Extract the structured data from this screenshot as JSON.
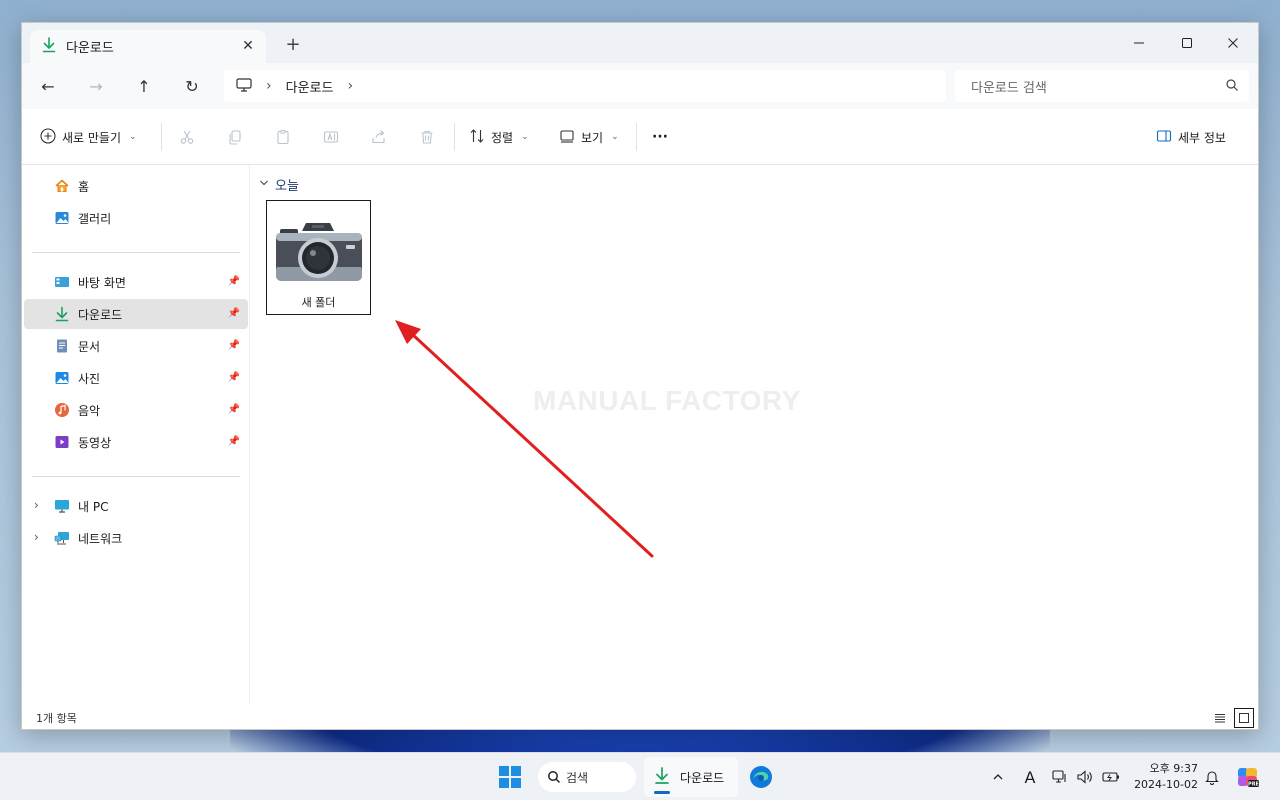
{
  "window": {
    "tab_title": "다운로드",
    "tab_close": "✕",
    "new_tab": "+"
  },
  "nav": {
    "back": "←",
    "forward": "→",
    "up": "↑",
    "refresh": "↻"
  },
  "address": {
    "crumbs": [
      "다운로드"
    ],
    "chevron": "›"
  },
  "search": {
    "placeholder": "다운로드 검색"
  },
  "toolbar": {
    "new_label": "새로 만들기",
    "sort_label": "정렬",
    "view_label": "보기",
    "more_label": "···",
    "details_label": "세부 정보"
  },
  "sidebar": {
    "items": [
      {
        "label": "홈",
        "icon": "home-icon"
      },
      {
        "label": "갤러리",
        "icon": "gallery-icon"
      },
      {
        "label": "바탕 화면",
        "icon": "desktop-icon",
        "pinned": true
      },
      {
        "label": "다운로드",
        "icon": "download-icon",
        "pinned": true,
        "selected": true
      },
      {
        "label": "문서",
        "icon": "document-icon",
        "pinned": true
      },
      {
        "label": "사진",
        "icon": "pictures-icon",
        "pinned": true
      },
      {
        "label": "음악",
        "icon": "music-icon",
        "pinned": true
      },
      {
        "label": "동영상",
        "icon": "video-icon",
        "pinned": true
      },
      {
        "label": "내 PC",
        "icon": "pc-icon",
        "expandable": true
      },
      {
        "label": "네트워크",
        "icon": "network-icon",
        "expandable": true
      }
    ]
  },
  "content": {
    "group_label": "오늘",
    "files": [
      {
        "name": "새 폴더",
        "icon": "camera-icon"
      }
    ],
    "watermark": "MANUAL FACTORY"
  },
  "status": {
    "item_count": "1개 항목"
  },
  "taskbar": {
    "search_label": "검색",
    "active_app_label": "다운로드",
    "time": "오후 9:37",
    "date": "2024-10-02"
  },
  "colors": {
    "accent": "#0f6cbd",
    "annotation_arrow": "#e02020",
    "download_green": "#1aa260"
  }
}
